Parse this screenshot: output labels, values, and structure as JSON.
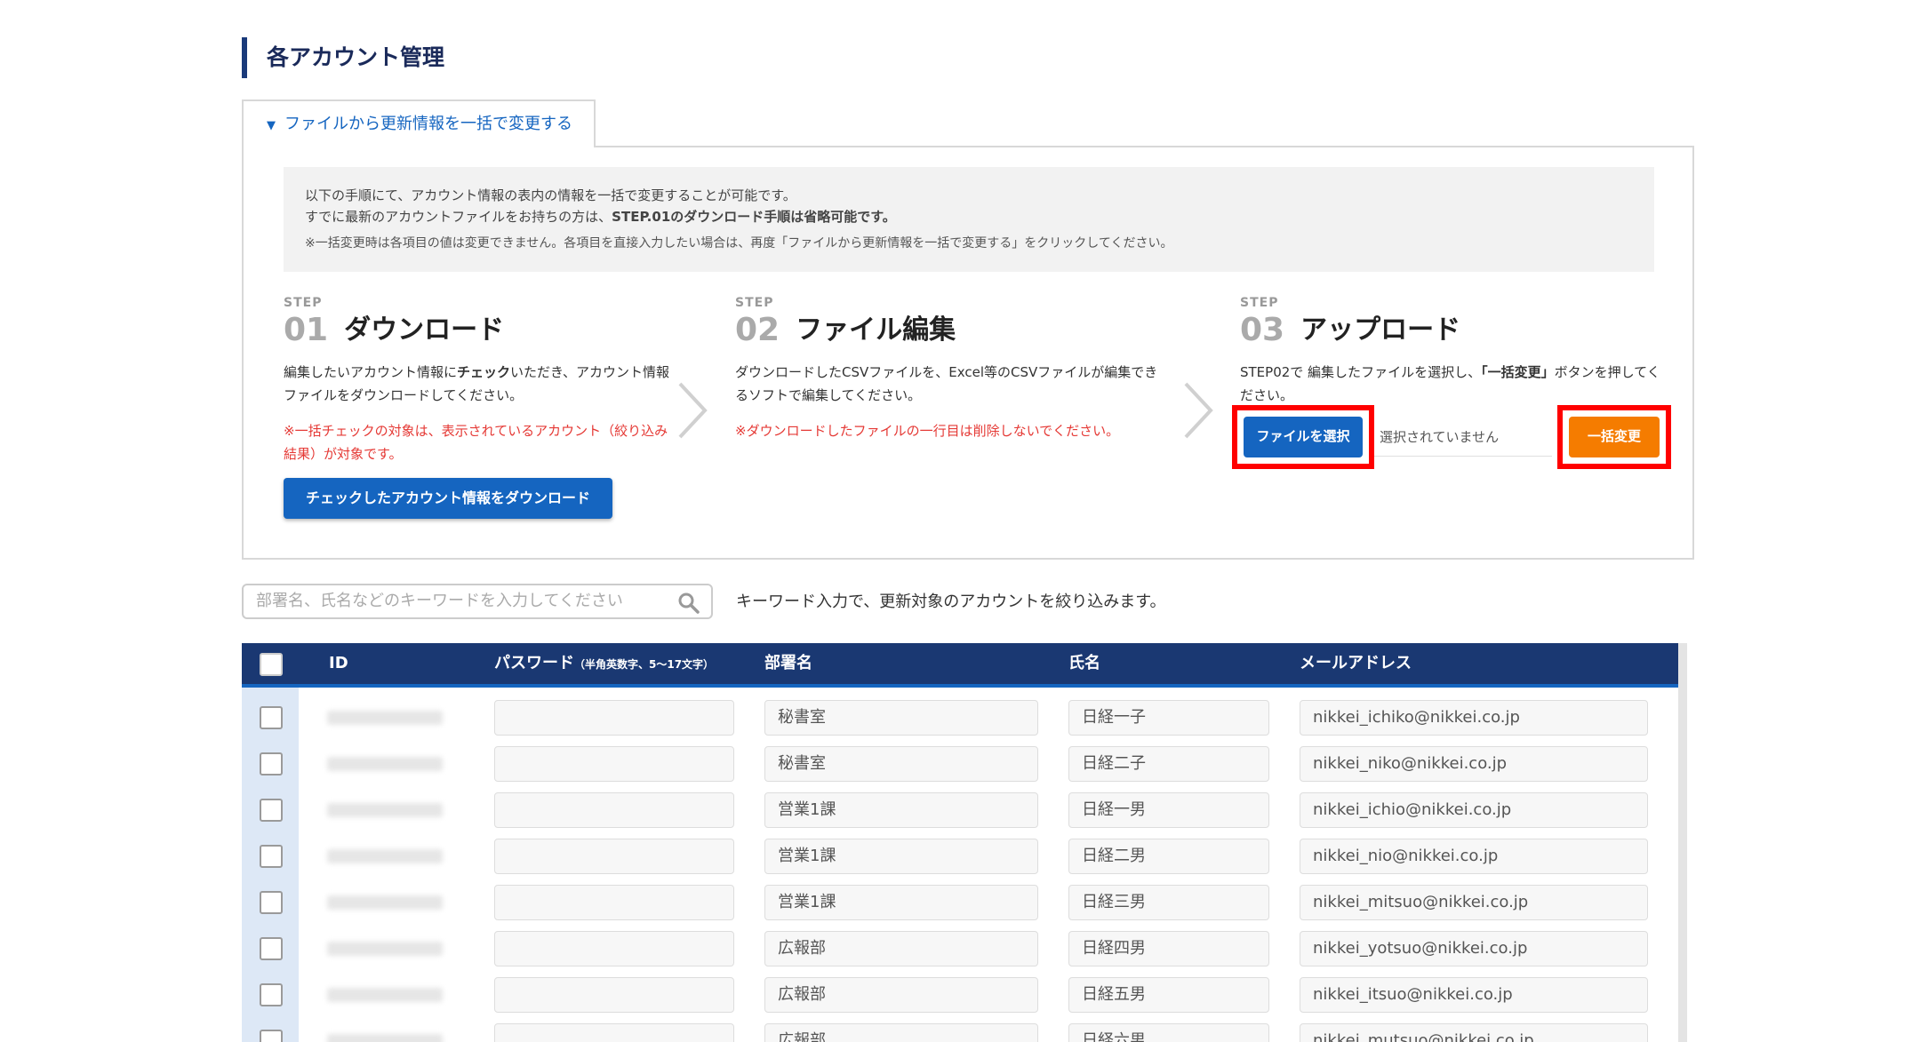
{
  "page": {
    "title": "各アカウント管理"
  },
  "tab": {
    "label": "ファイルから更新情報を一括で変更する"
  },
  "notice": {
    "line1": "以下の手順にて、アカウント情報の表内の情報を一括で変更することが可能です。",
    "line2_pre": "すでに最新のアカウントファイルをお持ちの方は、",
    "line2_bold": "STEP.01のダウンロード手順は省略可能です。",
    "line3": "※一括変更時は各項目の値は変更できません。各項目を直接入力したい場合は、再度「ファイルから更新情報を一括で変更する」をクリックしてください。"
  },
  "steps": [
    {
      "label": "STEP",
      "num": "01",
      "title": "ダウンロード",
      "desc_pre": "編集したいアカウント情報に",
      "desc_bold": "チェック",
      "desc_post": "いただき、アカウント情報ファイルをダウンロードしてください。",
      "warn": "※一括チェックの対象は、表示されているアカウント（絞り込み結果）が対象です。",
      "button": "チェックしたアカウント情報をダウンロード"
    },
    {
      "label": "STEP",
      "num": "02",
      "title": "ファイル編集",
      "desc": "ダウンロードしたCSVファイルを、Excel等のCSVファイルが編集できるソフトで編集してください。",
      "warn": "※ダウンロードしたファイルの一行目は削除しないでください。"
    },
    {
      "label": "STEP",
      "num": "03",
      "title": "アップロード",
      "desc_pre": "STEP02で 編集したファイルを選択し、",
      "desc_bold": "「一括変更」",
      "desc_post": "ボタンを押してください。",
      "file_button": "ファイルを選択",
      "file_status": "選択されていません",
      "change_button": "一括変更"
    }
  ],
  "search": {
    "placeholder": "部署名、氏名などのキーワードを入力してください",
    "hint": "キーワード入力で、更新対象のアカウントを絞り込みます。"
  },
  "table": {
    "headers": {
      "id": "ID",
      "password": "パスワード",
      "password_note": "（半角英数字、5～17文字）",
      "dept": "部署名",
      "name": "氏名",
      "email": "メールアドレス"
    },
    "rows": [
      {
        "dept": "秘書室",
        "name": "日経一子",
        "email": "nikkei_ichiko@nikkei.co.jp"
      },
      {
        "dept": "秘書室",
        "name": "日経二子",
        "email": "nikkei_niko@nikkei.co.jp"
      },
      {
        "dept": "営業1課",
        "name": "日経一男",
        "email": "nikkei_ichio@nikkei.co.jp"
      },
      {
        "dept": "営業1課",
        "name": "日経二男",
        "email": "nikkei_nio@nikkei.co.jp"
      },
      {
        "dept": "営業1課",
        "name": "日経三男",
        "email": "nikkei_mitsuo@nikkei.co.jp"
      },
      {
        "dept": "広報部",
        "name": "日経四男",
        "email": "nikkei_yotsuo@nikkei.co.jp"
      },
      {
        "dept": "広報部",
        "name": "日経五男",
        "email": "nikkei_itsuo@nikkei.co.jp"
      },
      {
        "dept": "広報部",
        "name": "日経六男",
        "email": "nikkei_mutsuo@nikkei.co.jp"
      }
    ]
  },
  "colors": {
    "primary": "#1565c0",
    "header_bg": "#1a3872",
    "accent_orange": "#f57c00",
    "highlight_red": "#ff0000",
    "warning_text": "#e53935"
  }
}
